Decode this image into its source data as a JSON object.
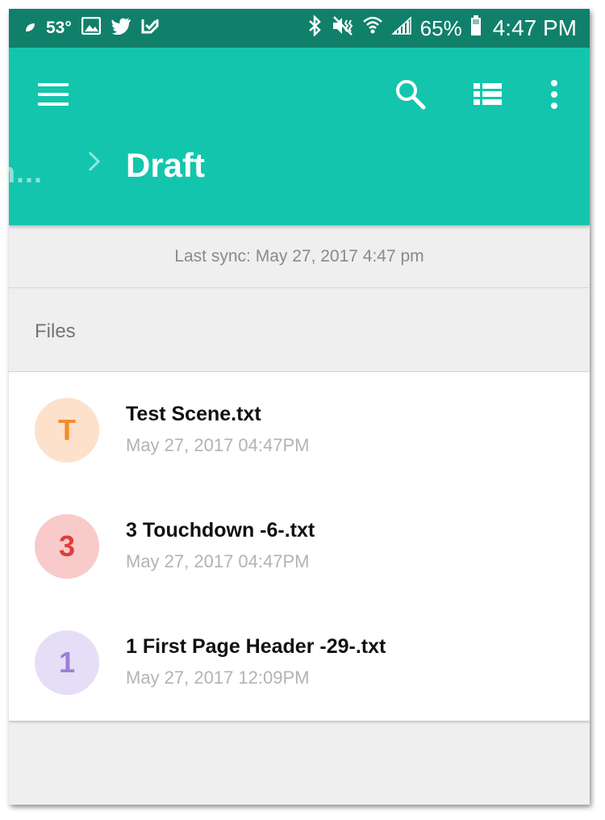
{
  "status_bar": {
    "temperature": "53°",
    "battery_percent": "65%",
    "time": "4:47 PM"
  },
  "app_bar": {
    "breadcrumb_previous": "n...",
    "title": "Draft",
    "color": "#13c5ad"
  },
  "sync": {
    "text": "Last sync: May 27, 2017 4:47 pm"
  },
  "files": {
    "header": "Files",
    "items": [
      {
        "initial": "T",
        "name": "Test Scene.txt",
        "date": "May 27, 2017 04:47PM",
        "avatar_bg": "#fde1cb",
        "avatar_fg": "#f58b2c"
      },
      {
        "initial": "3",
        "name": "3 Touchdown -6-.txt",
        "date": "May 27, 2017 04:47PM",
        "avatar_bg": "#f8caca",
        "avatar_fg": "#e23c3c"
      },
      {
        "initial": "1",
        "name": "1 First Page Header -29-.txt",
        "date": "May 27, 2017 12:09PM",
        "avatar_bg": "#e6def6",
        "avatar_fg": "#9a7fd6"
      }
    ]
  }
}
